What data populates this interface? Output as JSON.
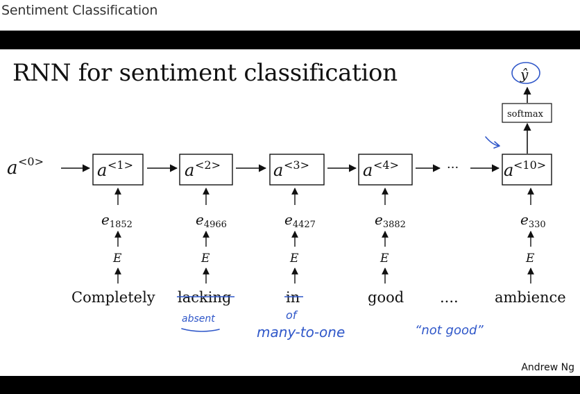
{
  "video_title": "Sentiment Classification",
  "slide": {
    "title": "RNN for sentiment classification",
    "footer": "Andrew Ng"
  },
  "diagram": {
    "initial_activation": {
      "base": "a",
      "sup": "<0>"
    },
    "output": {
      "label": "ŷ"
    },
    "softmax": "softmax",
    "ellipsis_between": "···",
    "ellipsis_words": "....",
    "embedding_matrix": "E",
    "cells": [
      {
        "sup": "<1>",
        "embedding": "1852",
        "word": "Completely"
      },
      {
        "sup": "<2>",
        "embedding": "4966",
        "word": "lacking",
        "struck": true
      },
      {
        "sup": "<3>",
        "embedding": "4427",
        "word": "in",
        "struck": true
      },
      {
        "sup": "<4>",
        "embedding": "3882",
        "word": "good"
      },
      {
        "sup": "<10>",
        "embedding": "330",
        "word": "ambience"
      }
    ]
  },
  "handwritten_annotations": {
    "under_lacking": "absent",
    "above_many_to_one": "of",
    "architecture_note": "many-to-one",
    "quote_note": "“not good”"
  },
  "colors": {
    "ink": "#2f57c9",
    "text": "#111111",
    "bars": "#000000"
  }
}
